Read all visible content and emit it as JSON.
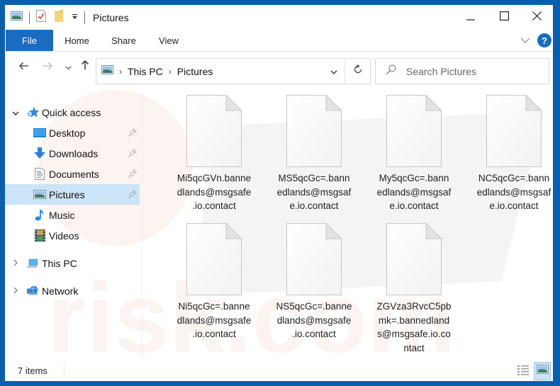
{
  "window": {
    "title": "Pictures",
    "controls": {
      "minimize": "minimize",
      "maximize": "maximize",
      "close": "close"
    }
  },
  "ribbon": {
    "tabs": [
      {
        "label": "File",
        "active": true
      },
      {
        "label": "Home"
      },
      {
        "label": "Share"
      },
      {
        "label": "View"
      }
    ],
    "help_label": "?"
  },
  "address": {
    "breadcrumbs": [
      "This PC",
      "Pictures"
    ],
    "search_placeholder": "Search Pictures"
  },
  "navpane": {
    "quick_access": {
      "label": "Quick access",
      "expanded": true
    },
    "items": [
      {
        "label": "Desktop",
        "icon": "desktop-icon",
        "pinned": true
      },
      {
        "label": "Downloads",
        "icon": "downloads-icon",
        "pinned": true
      },
      {
        "label": "Documents",
        "icon": "documents-icon",
        "pinned": true
      },
      {
        "label": "Pictures",
        "icon": "pictures-icon",
        "pinned": true,
        "selected": true
      },
      {
        "label": "Music",
        "icon": "music-icon",
        "pinned": false
      },
      {
        "label": "Videos",
        "icon": "videos-icon",
        "pinned": false
      }
    ],
    "this_pc": {
      "label": "This PC",
      "expanded": false
    },
    "network": {
      "label": "Network",
      "expanded": false
    }
  },
  "files": [
    {
      "name": "Mi5qcGVn.bannedlands@msgsafe.io.contact",
      "lines": [
        "Mi5qcGVn.banne",
        "dlands@msgsafe",
        ".io.contact"
      ]
    },
    {
      "name": "MS5qcGc=.bannedlands@msgsafe.io.contact",
      "lines": [
        "MS5qcGc=.bann",
        "edlands@msgsaf",
        "e.io.contact"
      ]
    },
    {
      "name": "My5qcGc=.bannedlands@msgsafe.io.contact",
      "lines": [
        "My5qcGc=.bann",
        "edlands@msgsaf",
        "e.io.contact"
      ]
    },
    {
      "name": "NC5qcGc=.bannedlands@msgsafe.io.contact",
      "lines": [
        "NC5qcGc=.bann",
        "edlands@msgsaf",
        "e.io.contact"
      ]
    },
    {
      "name": "Ni5qcGc=.bannedlands@msgsafe.io.contact",
      "lines": [
        "Ni5qcGc=.banne",
        "dlands@msgsafe",
        ".io.contact"
      ]
    },
    {
      "name": "NS5qcGc=.bannedlands@msgsafe.io.contact",
      "lines": [
        "NS5qcGc=.banne",
        "dlands@msgsafe",
        ".io.contact"
      ]
    },
    {
      "name": "ZGVza3RvcC5pbmk=.bannedlands@msgsafe.io.contact",
      "lines": [
        "ZGVza3RvcC5pb",
        "mk=.bannedland",
        "s@msgsafe.io.co",
        "ntact"
      ]
    }
  ],
  "status": {
    "item_count": "7 items"
  },
  "colors": {
    "accent": "#1a6cc0",
    "frame": "#0a5fad",
    "selection": "#cce4f7"
  }
}
